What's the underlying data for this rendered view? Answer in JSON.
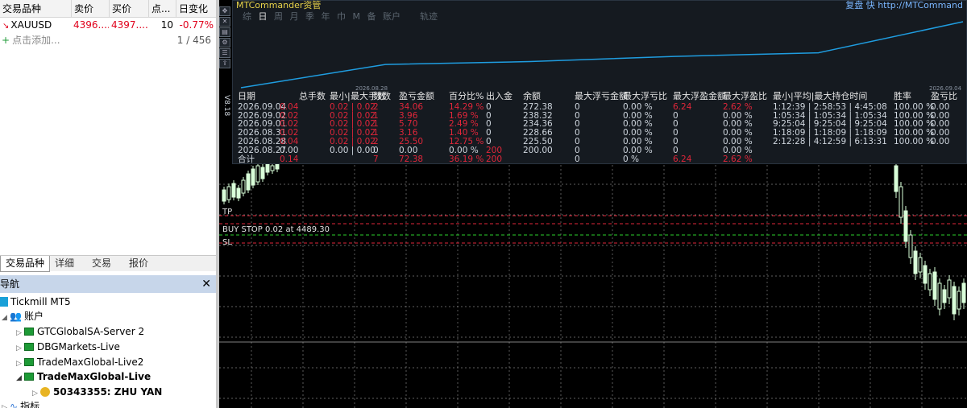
{
  "market_watch": {
    "headers": [
      "交易品种",
      "卖价",
      "买价",
      "点...",
      "日变化"
    ],
    "rows": [
      {
        "symbol": "XAUUSD",
        "bid": "4396....",
        "ask": "4397....",
        "spread": "10",
        "change": "-0.77%"
      }
    ],
    "add_label": "点击添加...",
    "count": "1 / 456",
    "tabs": [
      "交易品种",
      "详细",
      "交易",
      "报价"
    ]
  },
  "navigator": {
    "title": "导航",
    "items": [
      {
        "label": "Tickmill MT5"
      },
      {
        "label": "账户"
      },
      {
        "label": "GTCGlobalSA-Server 2"
      },
      {
        "label": "DBGMarkets-Live"
      },
      {
        "label": "TradeMaxGlobal-Live2"
      },
      {
        "label": "TradeMaxGlobal-Live"
      },
      {
        "label": "50343355: ZHU YAN"
      },
      {
        "label": "指标"
      }
    ]
  },
  "mtcommander": {
    "title": "MTCommander资管",
    "url": "复盘 快 http://MTCommand",
    "periods": [
      "综",
      "日",
      "周",
      "月",
      "季",
      "年",
      "巾",
      "M",
      "备",
      "账户"
    ],
    "selected_period": "日",
    "track_label": "轨迹",
    "chart_dates": [
      "2026.08.28",
      "2026.09.04"
    ],
    "side_label": "V8.18",
    "columns": [
      "日期",
      "总手数",
      "最小|",
      "最大手数",
      "数数",
      "盈亏金额",
      "百分比%",
      "出入金",
      "余额",
      "最大浮亏金额",
      "最大浮亏比",
      "最大浮盈金额",
      "最大浮盈比",
      "最小|平均|最大持仓时间",
      "胜率",
      "盈亏比"
    ],
    "rows": [
      {
        "date": "2026.09.04",
        "lots": "0.04",
        "minmax": "0.02 | 0.02",
        "count": "2",
        "pnl": "34.06",
        "pct": "14.29 %",
        "flow": "0",
        "balance": "272.38",
        "maxloss": "0",
        "maxlosspct": "0.00 %",
        "maxgain": "6.24",
        "maxgainpct": "2.62 %",
        "hold": "1:12:39 | 2:58:53 | 4:45:08",
        "winrate": "100.00 %",
        "pf": "0.00"
      },
      {
        "date": "2026.09.02",
        "lots": "0.02",
        "minmax": "0.02 | 0.02",
        "count": "1",
        "pnl": "3.96",
        "pct": "1.69 %",
        "flow": "0",
        "balance": "238.32",
        "maxloss": "0",
        "maxlosspct": "0.00 %",
        "maxgain": "0",
        "maxgainpct": "0.00 %",
        "hold": "1:05:34 | 1:05:34 | 1:05:34",
        "winrate": "100.00 %",
        "pf": "0.00"
      },
      {
        "date": "2026.09.01",
        "lots": "0.02",
        "minmax": "0.02 | 0.02",
        "count": "1",
        "pnl": "5.70",
        "pct": "2.49 %",
        "flow": "0",
        "balance": "234.36",
        "maxloss": "0",
        "maxlosspct": "0.00 %",
        "maxgain": "0",
        "maxgainpct": "0.00 %",
        "hold": "9:25:04 | 9:25:04 | 9:25:04",
        "winrate": "100.00 %",
        "pf": "0.00"
      },
      {
        "date": "2026.08.31",
        "lots": "0.02",
        "minmax": "0.02 | 0.02",
        "count": "1",
        "pnl": "3.16",
        "pct": "1.40 %",
        "flow": "0",
        "balance": "228.66",
        "maxloss": "0",
        "maxlosspct": "0.00 %",
        "maxgain": "0",
        "maxgainpct": "0.00 %",
        "hold": "1:18:09 | 1:18:09 | 1:18:09",
        "winrate": "100.00 %",
        "pf": "0.00"
      },
      {
        "date": "2026.08.28",
        "lots": "0.04",
        "minmax": "0.02 | 0.02",
        "count": "2",
        "pnl": "25.50",
        "pct": "12.75 %",
        "flow": "0",
        "balance": "225.50",
        "maxloss": "0",
        "maxlosspct": "0.00 %",
        "maxgain": "0",
        "maxgainpct": "0.00 %",
        "hold": "2:12:28 | 4:12:59 | 6:13:31",
        "winrate": "100.00 %",
        "pf": "0.00"
      },
      {
        "date": "2026.08.27",
        "lots": "0.00",
        "minmax": "0.00 | 0.00",
        "count": "0",
        "pnl": "0.00",
        "pct": "0.00 %",
        "flow": "200",
        "balance": "200.00",
        "maxloss": "0",
        "maxlosspct": "0.00 %",
        "maxgain": "0",
        "maxgainpct": "0.00 %",
        "hold": "",
        "winrate": "",
        "pf": ""
      }
    ],
    "total": {
      "label": "合计",
      "lots": "0.14",
      "count": "7",
      "pnl": "72.38",
      "pct": "36.19 %",
      "flow": "200",
      "maxloss": "0",
      "maxlosspct": "0 %",
      "maxgain": "6.24",
      "maxgainpct": "2.62 %"
    }
  },
  "chart": {
    "tp_label": "TP",
    "order_label": "BUY STOP 0.02 at 4489.30",
    "sl_label": "SL"
  },
  "colors": {
    "up_red": "#e0263a",
    "grid": "#808080",
    "equity_line": "#1f9de0"
  }
}
